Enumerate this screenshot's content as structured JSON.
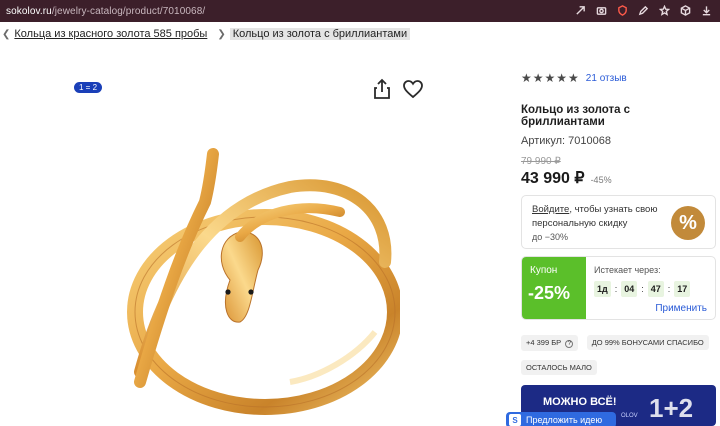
{
  "browser": {
    "url_host": "sokolov.ru",
    "url_path": "/jewelry-catalog/product/7010068/"
  },
  "breadcrumb": {
    "parent_label": "Кольца из красного золота 585 пробы",
    "current_label": "Кольцо из золота с бриллиантами"
  },
  "gallery": {
    "badge_label": "1 = 2"
  },
  "product": {
    "rating_stars": "★★★★★",
    "rating_value": 5,
    "reviews_label": "21 отзыв",
    "title": "Кольцо из золота с бриллиантами",
    "sku_label": "Артикул: 7010068",
    "old_price": "79 990 ₽",
    "price": "43 990 ₽",
    "discount": "-45%"
  },
  "personal_discount": {
    "login_label": "Войдите",
    "text": ", чтобы узнать свою персональную скидку",
    "sub": "до −30%",
    "icon_glyph": "%"
  },
  "coupon": {
    "label": "Купон",
    "value": "-25%",
    "expires_label": "Истекает через:",
    "timer": [
      "1д",
      "04",
      "47",
      "17"
    ],
    "apply_label": "Применить"
  },
  "chips": {
    "bonus_label": "+4 399 БР",
    "bonus_info": "?",
    "bonus_pay_label": "ДО 99% БОНУСАМИ СПАСИБО",
    "stock_label": "ОСТАЛОСЬ МАЛО"
  },
  "banner": {
    "text": "МОЖНО ВСЁ!",
    "brand": "OLOV",
    "big": "1+2"
  },
  "suggest": {
    "icon_glyph": "S",
    "label": "Предложить идею"
  },
  "colors": {
    "url_bar": "#3c1f2a",
    "link_blue": "#2a5bd7",
    "coupon_green": "#5bbf2a",
    "gold": "#c28a3a",
    "banner_blue": "#1c2a85"
  }
}
